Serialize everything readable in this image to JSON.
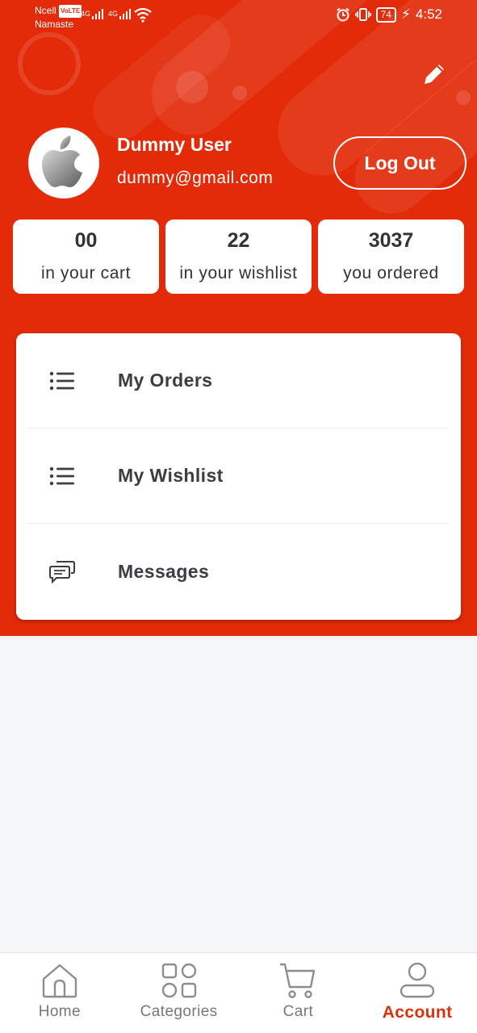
{
  "status_bar": {
    "carrier": "Ncell",
    "volte": "VoLTE",
    "network_name": "Namaste",
    "sig1": "4G",
    "sig2": "4G",
    "battery": "74",
    "time": "4:52"
  },
  "profile": {
    "name": "Dummy User",
    "email": "dummy@gmail.com",
    "logout_label": "Log Out"
  },
  "stats": [
    {
      "value": "00",
      "label": "in your cart"
    },
    {
      "value": "22",
      "label": "in your wishlist"
    },
    {
      "value": "3037",
      "label": "you ordered"
    }
  ],
  "menu": [
    {
      "label": "My Orders",
      "icon": "list-icon"
    },
    {
      "label": "My Wishlist",
      "icon": "list-icon"
    },
    {
      "label": "Messages",
      "icon": "chat-icon"
    }
  ],
  "nav": [
    {
      "label": "Home",
      "icon": "home-icon"
    },
    {
      "label": "Categories",
      "icon": "categories-icon"
    },
    {
      "label": "Cart",
      "icon": "cart-icon"
    },
    {
      "label": "Account",
      "icon": "account-icon",
      "active": true
    }
  ],
  "colors": {
    "brand": "#e32b0a",
    "active_nav": "#d9320e",
    "background": "#f4f5f7"
  }
}
